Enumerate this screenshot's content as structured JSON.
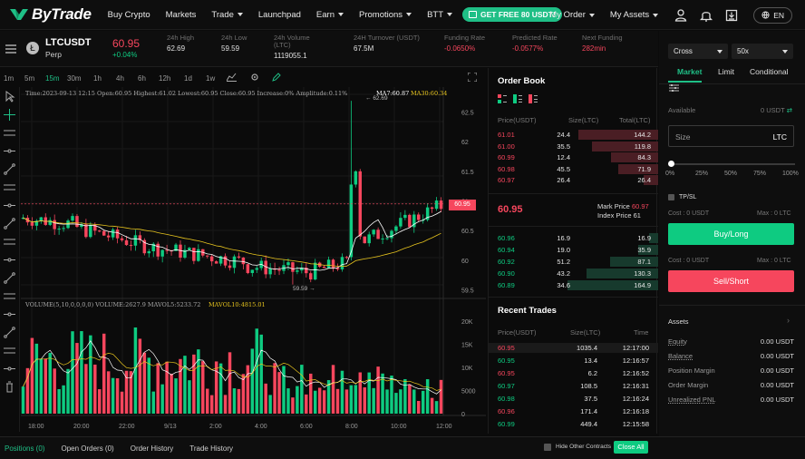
{
  "nav": {
    "logo": "ByTrade",
    "items": [
      {
        "label": "Buy Crypto",
        "caret": false
      },
      {
        "label": "Markets",
        "caret": false
      },
      {
        "label": "Trade",
        "caret": true
      },
      {
        "label": "Launchpad",
        "caret": false
      },
      {
        "label": "Earn",
        "caret": true
      },
      {
        "label": "Promotions",
        "caret": true
      },
      {
        "label": "BTT",
        "caret": true
      }
    ],
    "promo": "GET FREE 80 USDT!",
    "my_order": "My Order",
    "my_assets": "My Assets",
    "lang": "EN"
  },
  "ticker": {
    "symbol": "LTCUSDT",
    "sub": "Perp",
    "price": "60.95",
    "change": "+0.04%",
    "stats": [
      {
        "label": "24h High",
        "value": "62.69",
        "color": "#e0e0e0"
      },
      {
        "label": "24h Low",
        "value": "59.59",
        "color": "#e0e0e0"
      },
      {
        "label": "24h Volume (LTC)",
        "value": "1119055.1",
        "color": "#e0e0e0"
      },
      {
        "label": "24H Turnover (USDT)",
        "value": "67.5M",
        "color": "#e0e0e0"
      },
      {
        "label": "Funding Rate",
        "value": "-0.0650%",
        "color": "#f6465d"
      },
      {
        "label": "Predicted Rate",
        "value": "-0.0577%",
        "color": "#f6465d"
      },
      {
        "label": "Next Funding",
        "value": "282min",
        "color": "#f6465d"
      }
    ]
  },
  "toolbar": {
    "intervals": [
      "1m",
      "5m",
      "15m",
      "30m",
      "1h",
      "4h",
      "6h",
      "12h",
      "1d",
      "1w"
    ],
    "active": "15m"
  },
  "chart_info": {
    "line1": "Time:2023-09-13 12:15   Open:60.95   Highest:61.02   Lowest:60.95   Close:60.95   Increase:0%   Amplitude:0.11%",
    "ma7": "MA7:60.87",
    "ma30": "MA30:60.34",
    "vol_line": "VOLUME(5,10,0,0,0,0)   VOLUME:2627.9   MAVOL5:5233.72",
    "mavol10": "MAVOL10:4815.01",
    "high_label": "62.69",
    "low_label": "59.59",
    "price_tag": "60.95"
  },
  "chart_data": {
    "type": "candlestick",
    "price_axis": [
      "62.5",
      "62",
      "61.5",
      "61",
      "60.5",
      "60",
      "59.5"
    ],
    "price_ylim": [
      59.5,
      62.69
    ],
    "volume_axis": [
      "20K",
      "15K",
      "10K",
      "5000",
      "0"
    ],
    "x_ticks": [
      "18:00",
      "20:00",
      "22:00",
      "9/13",
      "2:00",
      "4:00",
      "6:00",
      "8:00",
      "10:00",
      "12:00"
    ]
  },
  "orderbook": {
    "title": "Order Book",
    "headers": [
      "Price(USDT)",
      "Size(LTC)",
      "Total(LTC)"
    ],
    "asks": [
      {
        "price": "61.01",
        "size": "24.4",
        "total": "144.2",
        "depth": 0.88
      },
      {
        "price": "61.00",
        "size": "35.5",
        "total": "119.8",
        "depth": 0.73
      },
      {
        "price": "60.99",
        "size": "12.4",
        "total": "84.3",
        "depth": 0.52
      },
      {
        "price": "60.98",
        "size": "45.5",
        "total": "71.9",
        "depth": 0.44
      },
      {
        "price": "60.97",
        "size": "26.4",
        "total": "26.4",
        "depth": 0.16
      }
    ],
    "mid_price": "60.95",
    "mark_label": "Mark Price",
    "mark_price": "60.97",
    "index_label": "Index Price",
    "index_price": "61",
    "bids": [
      {
        "price": "60.96",
        "size": "16.9",
        "total": "16.9",
        "depth": 0.1
      },
      {
        "price": "60.94",
        "size": "19.0",
        "total": "35.9",
        "depth": 0.22
      },
      {
        "price": "60.92",
        "size": "51.2",
        "total": "87.1",
        "depth": 0.53
      },
      {
        "price": "60.90",
        "size": "43.2",
        "total": "130.3",
        "depth": 0.79
      },
      {
        "price": "60.89",
        "size": "34.6",
        "total": "164.9",
        "depth": 1.0
      }
    ]
  },
  "trades": {
    "title": "Recent Trades",
    "headers": [
      "Price(USDT)",
      "Size(LTC)",
      "Time"
    ],
    "rows": [
      {
        "price": "60.95",
        "size": "1035.4",
        "time": "12:17:00",
        "side": "sell"
      },
      {
        "price": "60.95",
        "size": "13.4",
        "time": "12:16:57",
        "side": "buy"
      },
      {
        "price": "60.95",
        "size": "6.2",
        "time": "12:16:52",
        "side": "sell"
      },
      {
        "price": "60.97",
        "size": "108.5",
        "time": "12:16:31",
        "side": "buy"
      },
      {
        "price": "60.98",
        "size": "37.5",
        "time": "12:16:24",
        "side": "buy"
      },
      {
        "price": "60.96",
        "size": "171.4",
        "time": "12:16:18",
        "side": "sell"
      },
      {
        "price": "60.99",
        "size": "449.4",
        "time": "12:15:58",
        "side": "buy"
      }
    ]
  },
  "order_panel": {
    "margin_mode": "Cross",
    "leverage": "50x",
    "tabs": [
      "Market",
      "Limit",
      "Conditional"
    ],
    "available_label": "Available",
    "available_value": "0 USDT",
    "size_placeholder": "Size",
    "size_unit": "LTC",
    "slider_marks": [
      "0%",
      "25%",
      "50%",
      "75%",
      "100%"
    ],
    "tpsl": "TP/SL",
    "cost_label": "Cost : 0 USDT",
    "max_label": "Max : 0 LTC",
    "buy": "Buy/Long",
    "sell": "Sell/Short",
    "assets_title": "Assets",
    "assets": [
      {
        "label": "Equity",
        "value": "0.00 USDT"
      },
      {
        "label": "Balance",
        "value": "0.00 USDT"
      },
      {
        "label": "Position Margin",
        "value": "0.00 USDT"
      },
      {
        "label": "Order Margin",
        "value": "0.00 USDT"
      },
      {
        "label": "Unrealized PNL",
        "value": "0.00 USDT"
      }
    ]
  },
  "bottom": {
    "tabs": [
      "Positions (0)",
      "Open Orders (0)",
      "Order History",
      "Trade History"
    ],
    "hide_other": "Hide Other Contracts",
    "close_all": "Close All"
  },
  "colors": {
    "green": "#0ecb81",
    "red": "#f6465d",
    "accent": "#1fbf86"
  }
}
